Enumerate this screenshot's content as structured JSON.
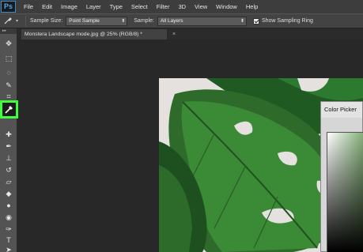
{
  "app": {
    "logo": "Ps"
  },
  "menu": [
    "File",
    "Edit",
    "Image",
    "Layer",
    "Type",
    "Select",
    "Filter",
    "3D",
    "View",
    "Window",
    "Help"
  ],
  "options": {
    "tool_icon": "eyedropper-icon",
    "sample_size_label": "Sample Size:",
    "sample_size_value": "Point Sample",
    "sample_label": "Sample:",
    "sample_value": "All Layers",
    "show_ring_label": "Show Sampling Ring",
    "show_ring_checked": true
  },
  "document_tab": {
    "title": "Monstera Landscape mode.jpg @ 25% (RGB/8) *",
    "close": "×"
  },
  "tools_panel": {
    "collapse": "▸▸",
    "active_tool": "eyedropper-icon",
    "highlight_color": "#3dff3d"
  },
  "color_picker": {
    "title": "Color Picker"
  }
}
